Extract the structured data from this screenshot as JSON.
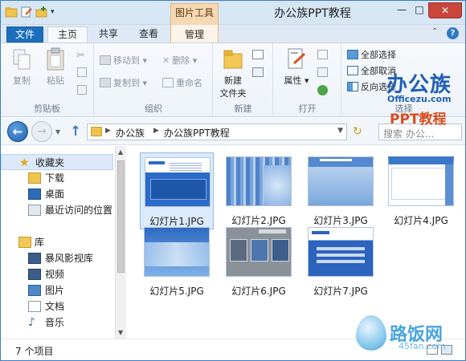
{
  "titlebar": {
    "title": "办公族PPT教程",
    "context_tab_group": "图片工具",
    "minimize": "—",
    "maximize": "□",
    "close": "✕"
  },
  "ribbon_tabs": {
    "file": "文件",
    "home": "主页",
    "share": "共享",
    "view": "查看",
    "manage": "管理",
    "help": "?"
  },
  "ribbon": {
    "clipboard": {
      "label": "剪贴板",
      "copy": "复制",
      "paste": "粘贴"
    },
    "organize": {
      "label": "组织",
      "move_to": "移动到",
      "copy_to": "复制到",
      "delete": "删除",
      "rename": "重命名"
    },
    "new": {
      "label": "新建",
      "new_folder_line1": "新建",
      "new_folder_line2": "文件夹"
    },
    "open": {
      "label": "打开",
      "properties": "属性"
    },
    "select": {
      "label": "选择",
      "select_all": "全部选择",
      "select_none": "全部取消",
      "invert": "反向选择"
    }
  },
  "navbar": {
    "breadcrumb": [
      "办公族",
      "办公族PPT教程"
    ],
    "search_placeholder": "搜索 办公..."
  },
  "sidebar": {
    "items": [
      {
        "label": "收藏夹",
        "icon": "star-icon"
      },
      {
        "label": "下载",
        "icon": "download-folder-icon"
      },
      {
        "label": "桌面",
        "icon": "desktop-icon"
      },
      {
        "label": "最近访问的位置",
        "icon": "recent-places-icon"
      },
      {
        "label": "库",
        "icon": "library-icon"
      },
      {
        "label": "暴风影视库",
        "icon": "video-library-icon"
      },
      {
        "label": "视频",
        "icon": "video-icon"
      },
      {
        "label": "图片",
        "icon": "pictures-icon"
      },
      {
        "label": "文档",
        "icon": "documents-icon"
      },
      {
        "label": "音乐",
        "icon": "music-icon"
      }
    ]
  },
  "files": [
    {
      "name": "幻灯片1.JPG"
    },
    {
      "name": "幻灯片2.JPG"
    },
    {
      "name": "幻灯片3.JPG"
    },
    {
      "name": "幻灯片4.JPG"
    },
    {
      "name": "幻灯片5.JPG"
    },
    {
      "name": "幻灯片6.JPG"
    },
    {
      "name": "幻灯片7.JPG"
    }
  ],
  "statusbar": {
    "item_count": "7 个项目"
  },
  "watermarks": {
    "officezu_cn": "办公族",
    "officezu_en": "Officezu.com",
    "ppt_tutorial": "PPT教程",
    "site_cn": "路饭网",
    "site_en": "45fan.com"
  },
  "colors": {
    "file_tab": "#1c6fbe",
    "context_tab": "#f6d8b2",
    "close_button": "#c9463d",
    "selection": "#dcebfb"
  }
}
